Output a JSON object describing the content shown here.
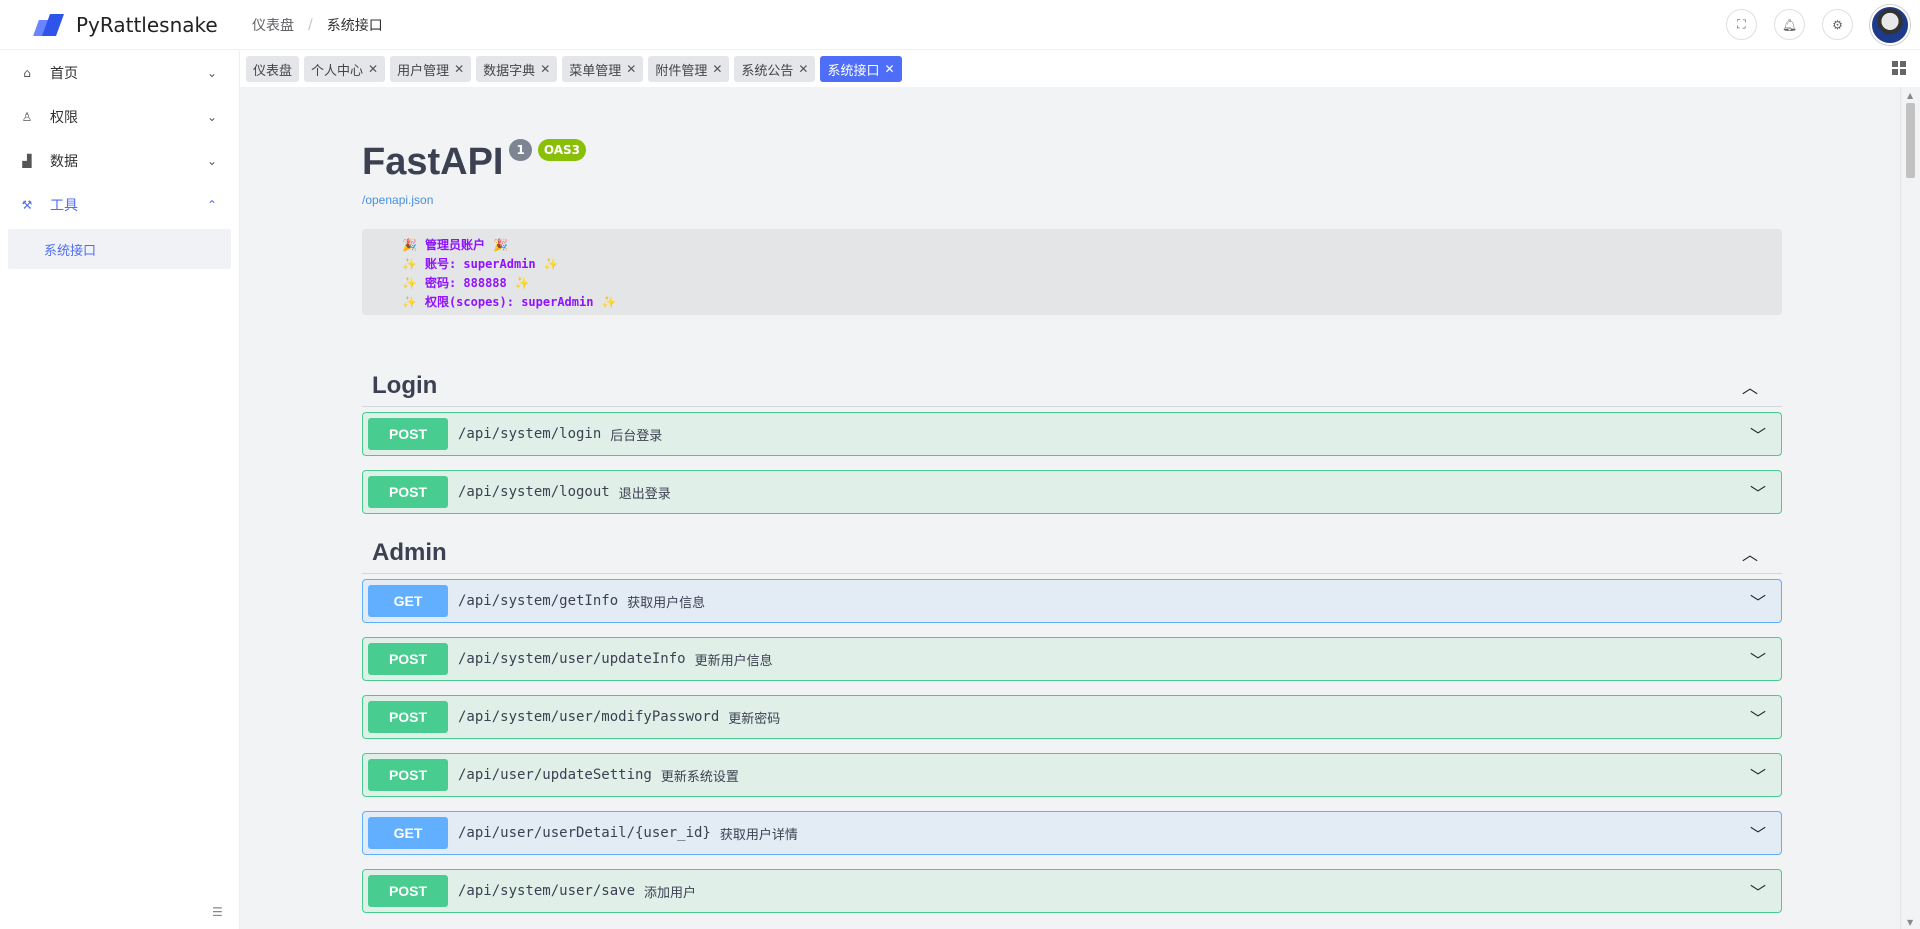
{
  "app": {
    "name": "PyRattlesnake"
  },
  "breadcrumb": {
    "items": [
      "仪表盘",
      "系统接口"
    ],
    "separator": "/"
  },
  "sidebar": {
    "items": [
      {
        "label": "首页",
        "icon": "home-icon",
        "chevron": "⌄"
      },
      {
        "label": "权限",
        "icon": "user-icon",
        "chevron": "⌄"
      },
      {
        "label": "数据",
        "icon": "chart-icon",
        "chevron": "⌄"
      },
      {
        "label": "工具",
        "icon": "wrench-icon",
        "chevron": "⌃"
      }
    ],
    "submenu": {
      "label": "系统接口"
    }
  },
  "tags": [
    {
      "label": "仪表盘"
    },
    {
      "label": "个人中心"
    },
    {
      "label": "用户管理"
    },
    {
      "label": "数据字典"
    },
    {
      "label": "菜单管理"
    },
    {
      "label": "附件管理"
    },
    {
      "label": "系统公告"
    },
    {
      "label": "系统接口"
    }
  ],
  "swagger": {
    "title": "FastAPI",
    "version": "1",
    "oas": "OAS3",
    "spec_link": "/openapi.json",
    "description": [
      {
        "emoji": "🎉",
        "text": "管理员账户",
        "emoji_end": "🎉"
      },
      {
        "emoji": "✨",
        "text": "账号: superAdmin",
        "emoji_end": "✨"
      },
      {
        "emoji": "✨",
        "text": "密码: 888888",
        "emoji_end": "✨"
      },
      {
        "emoji": "✨",
        "text": "权限(scopes): superAdmin",
        "emoji_end": "✨"
      }
    ],
    "sections": [
      {
        "title": "Login",
        "ops": [
          {
            "method": "POST",
            "path": "/api/system/login",
            "summary": "后台登录"
          },
          {
            "method": "POST",
            "path": "/api/system/logout",
            "summary": "退出登录"
          }
        ]
      },
      {
        "title": "Admin",
        "ops": [
          {
            "method": "GET",
            "path": "/api/system/getInfo",
            "summary": "获取用户信息"
          },
          {
            "method": "POST",
            "path": "/api/system/user/updateInfo",
            "summary": "更新用户信息"
          },
          {
            "method": "POST",
            "path": "/api/system/user/modifyPassword",
            "summary": "更新密码"
          },
          {
            "method": "POST",
            "path": "/api/user/updateSetting",
            "summary": "更新系统设置"
          },
          {
            "method": "GET",
            "path": "/api/user/userDetail/{user_id}",
            "summary": "获取用户详情"
          },
          {
            "method": "POST",
            "path": "/api/system/user/save",
            "summary": "添加用户"
          }
        ]
      }
    ]
  },
  "colors": {
    "accent": "#4f6ef7",
    "post": "#49cc90",
    "get": "#61affe"
  }
}
